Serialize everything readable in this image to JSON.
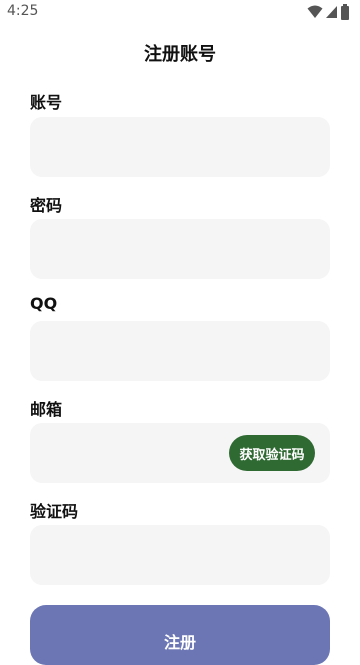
{
  "status_bar": {
    "time": "4:25"
  },
  "header": {
    "title": "注册账号"
  },
  "form": {
    "account": {
      "label": "账号",
      "value": "",
      "placeholder": ""
    },
    "password": {
      "label": "密码",
      "value": "",
      "placeholder": ""
    },
    "qq": {
      "label": "QQ",
      "value": "",
      "placeholder": ""
    },
    "email": {
      "label": "邮箱",
      "value": "",
      "placeholder": ""
    },
    "get_code_label": "获取验证码",
    "code": {
      "label": "验证码",
      "value": "",
      "placeholder": ""
    },
    "submit_label": "注册"
  },
  "colors": {
    "input_background": "#f5f5f5",
    "code_button": "#2f6a33",
    "submit_button": "#6c76b5"
  },
  "icons": [
    "wifi-icon",
    "cellular-signal-icon",
    "battery-icon"
  ]
}
